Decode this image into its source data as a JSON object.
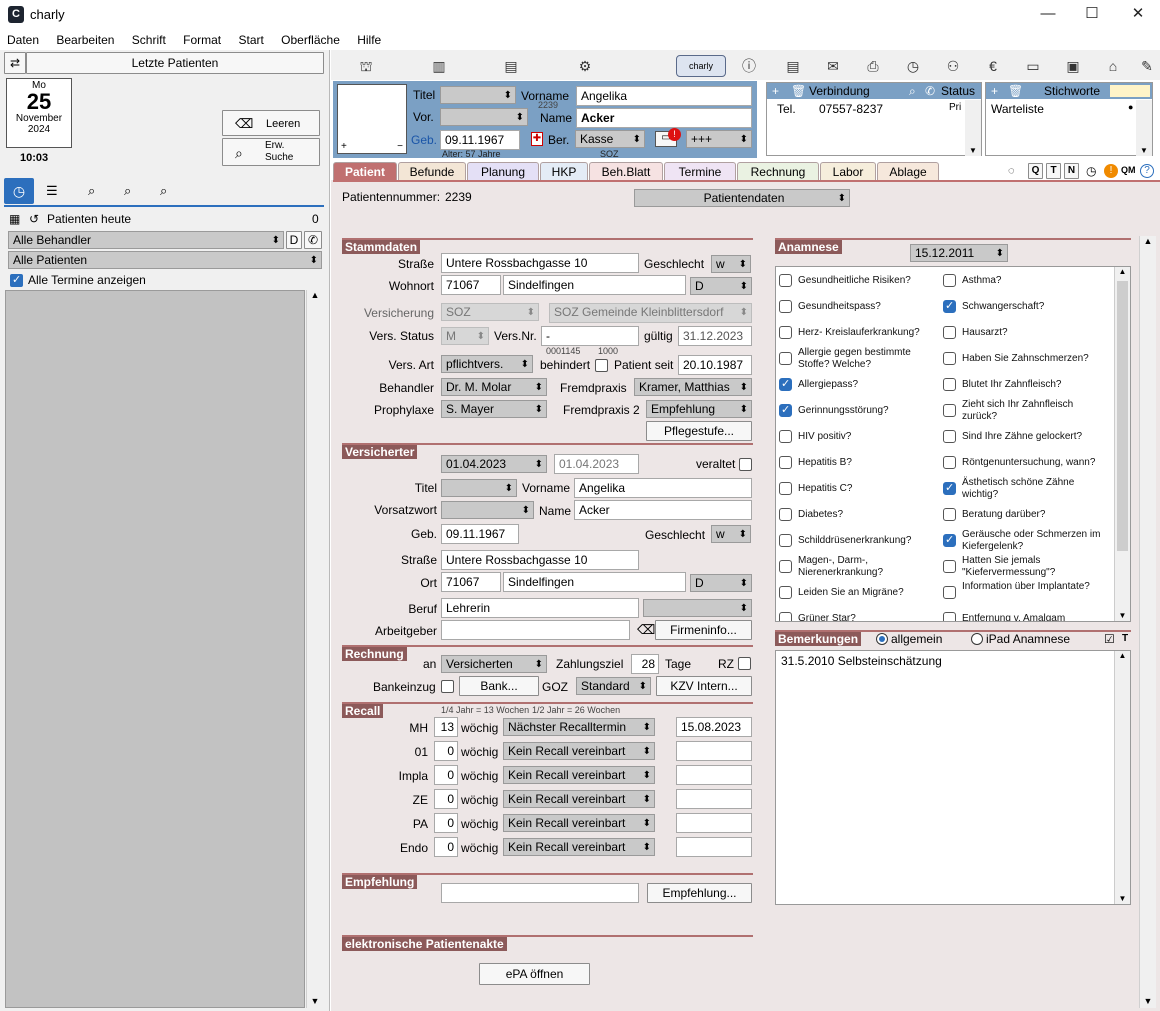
{
  "window": {
    "title": "charly",
    "app_icon": "C",
    "minimize": "—",
    "maximize": "☐",
    "close": "✕"
  },
  "menu": [
    "Daten",
    "Bearbeiten",
    "Schrift",
    "Format",
    "Start",
    "Oberfläche",
    "Hilfe"
  ],
  "left": {
    "swap_icon": "⇄",
    "recent_patients": "Letzte Patienten",
    "calendar": {
      "weekday": "Mo",
      "day": "25",
      "month": "November",
      "year": "2024",
      "time": "10:03"
    },
    "clear_label": "Leeren",
    "ext_search_label_1": "Erw.",
    "ext_search_label_2": "Suche",
    "today_label": "Patienten heute",
    "today_count": "0",
    "behandler": "Alle Behandler",
    "d_label": "D",
    "patients": "Alle Patienten",
    "show_all": "Alle Termine anzeigen"
  },
  "header": {
    "titel_label": "Titel",
    "vorname_label": "Vorname",
    "vorname": "Angelika",
    "id_small": "2239",
    "vor_label": "Vor.",
    "name_label": "Name",
    "name": "Acker",
    "geb_label": "Geb.",
    "geb": "09.11.1967",
    "alter": "Alter: 57 Jahre",
    "ber_label": "Ber.",
    "kasse": "Kasse",
    "kasse_sub": "SOZ",
    "plus": "+++",
    "photo_plus": "+",
    "photo_minus": "−",
    "warn_badge": "!",
    "verbindung": "Verbindung",
    "status": "Status",
    "tel_label": "Tel.",
    "tel": "07557-8237",
    "tel_suffix": "Pri",
    "stichworte": "Stichworte",
    "warteliste": "Warteliste",
    "charly_badge": "charly"
  },
  "tabs": [
    {
      "label": "Patient",
      "bg": "#c07070",
      "color": "#ffffff"
    },
    {
      "label": "Befunde",
      "bg": "#f3e6d6"
    },
    {
      "label": "Planung",
      "bg": "#e4e0f6"
    },
    {
      "label": "HKP",
      "bg": "#e4ecf6"
    },
    {
      "label": "Beh.Blatt",
      "bg": "#f6e2e2"
    },
    {
      "label": "Termine",
      "bg": "#efe4f4"
    },
    {
      "label": "Rechnung",
      "bg": "#eaf2e2"
    },
    {
      "label": "Labor",
      "bg": "#f6eedc"
    },
    {
      "label": "Ablage",
      "bg": "#f6e8dc"
    }
  ],
  "tab_tools": [
    "Q",
    "T",
    "N",
    "QM",
    "?"
  ],
  "patient": {
    "nummer_label": "Patientennummer:",
    "nummer": "2239",
    "view_select": "Patientendaten",
    "stammdaten": {
      "title": "Stammdaten",
      "strasse_label": "Straße",
      "strasse": "Untere Rossbachgasse 10",
      "geschlecht_label": "Geschlecht",
      "geschlecht": "w",
      "wohnort_label": "Wohnort",
      "plz": "71067",
      "ort": "Sindelfingen",
      "land": "D",
      "vers_label": "Versicherung",
      "vers": "SOZ",
      "vers_name": "SOZ Gemeinde Kleinblittersdorf",
      "status_label": "Vers. Status",
      "status": "M",
      "versnr_label": "Vers.Nr.",
      "versnr": "-",
      "gueltig_label": "gültig",
      "gueltig": "31.12.2023",
      "small1": "0001145",
      "small2": "1000",
      "art_label": "Vers. Art",
      "art": "pflichtvers.",
      "behindert_label": "behindert",
      "seit_label": "Patient seit",
      "seit": "20.10.1987",
      "behandler_label": "Behandler",
      "behandler": "Dr. M. Molar",
      "fremd_label": "Fremdpraxis",
      "fremd": "Kramer, Matthias",
      "prophylaxe_label": "Prophylaxe",
      "prophylaxe": "S. Mayer",
      "fremd2_label": "Fremdpraxis 2",
      "fremd2": "Empfehlung",
      "pflege": "Pflegestufe..."
    },
    "versicherter": {
      "title": "Versicherter",
      "date1": "01.04.2023",
      "date2": "01.04.2023",
      "veraltet": "veraltet",
      "titel_label": "Titel",
      "vorname_label": "Vorname",
      "vorname": "Angelika",
      "vorsatz_label": "Vorsatzwort",
      "name_label": "Name",
      "name": "Acker",
      "geb_label": "Geb.",
      "geb": "09.11.1967",
      "geschlecht_label": "Geschlecht",
      "geschlecht": "w",
      "strasse_label": "Straße",
      "strasse": "Untere Rossbachgasse 10",
      "ort_label": "Ort",
      "plz": "71067",
      "ort": "Sindelfingen",
      "land": "D",
      "beruf_label": "Beruf",
      "beruf": "Lehrerin",
      "arbeitgeber_label": "Arbeitgeber",
      "firmen": "Firmeninfo..."
    },
    "rechnung": {
      "title": "Rechnung",
      "an_label": "an",
      "an": "Versicherten",
      "ziel_label": "Zahlungsziel",
      "ziel": "28",
      "tage": "Tage",
      "rz": "RZ",
      "bank_label": "Bankeinzug",
      "bank_btn": "Bank...",
      "goz_label": "GOZ",
      "goz": "Standard",
      "kzv": "KZV Intern..."
    },
    "recall": {
      "title": "Recall",
      "hint1": "1/4 Jahr = 13 Wochen",
      "hint2": "1/2 Jahr = 26 Wochen",
      "rows": [
        {
          "label": "MH",
          "num": "13",
          "unit": "wöchig",
          "select": "Nächster Recalltermin",
          "date": "15.08.2023"
        },
        {
          "label": "01",
          "num": "0",
          "unit": "wöchig",
          "select": "Kein Recall vereinbart",
          "date": ""
        },
        {
          "label": "Impla",
          "num": "0",
          "unit": "wöchig",
          "select": "Kein Recall vereinbart",
          "date": ""
        },
        {
          "label": "ZE",
          "num": "0",
          "unit": "wöchig",
          "select": "Kein Recall vereinbart",
          "date": ""
        },
        {
          "label": "PA",
          "num": "0",
          "unit": "wöchig",
          "select": "Kein Recall vereinbart",
          "date": ""
        },
        {
          "label": "Endo",
          "num": "0",
          "unit": "wöchig",
          "select": "Kein Recall vereinbart",
          "date": ""
        }
      ]
    },
    "empfehlung": {
      "title": "Empfehlung",
      "btn": "Empfehlung..."
    },
    "epa": {
      "title": "elektronische Patientenakte",
      "btn": "ePA öffnen"
    },
    "anamnese": {
      "title": "Anamnese",
      "date": "15.12.2011",
      "left": [
        {
          "t": "Gesundheitliche Risiken?",
          "c": false
        },
        {
          "t": "Gesundheitspass?",
          "c": false
        },
        {
          "t": "Herz- Kreislauferkrankung?",
          "c": false
        },
        {
          "t": "Allergie gegen bestimmte Stoffe? Welche?",
          "c": false
        },
        {
          "t": "Allergiepass?",
          "c": true
        },
        {
          "t": "Gerinnungsstörung?",
          "c": true
        },
        {
          "t": "HIV positiv?",
          "c": false
        },
        {
          "t": "Hepatitis B?",
          "c": false
        },
        {
          "t": "Hepatitis C?",
          "c": false
        },
        {
          "t": "Diabetes?",
          "c": false
        },
        {
          "t": "Schilddrüsenerkrankung?",
          "c": false
        },
        {
          "t": "Magen-, Darm-, Nierenerkrankung?",
          "c": false
        },
        {
          "t": "Leiden Sie an Migräne?",
          "c": false
        },
        {
          "t": "Grüner Star?",
          "c": false
        }
      ],
      "right": [
        {
          "t": "Asthma?",
          "c": false
        },
        {
          "t": "Schwangerschaft?",
          "c": true
        },
        {
          "t": "Hausarzt?",
          "c": false
        },
        {
          "t": "Haben Sie Zahnschmerzen?",
          "c": false
        },
        {
          "t": "Blutet Ihr Zahnfleisch?",
          "c": false
        },
        {
          "t": "Zieht sich Ihr Zahnfleisch zurück?",
          "c": false
        },
        {
          "t": "Sind Ihre Zähne gelockert?",
          "c": false
        },
        {
          "t": "Röntgenuntersuchung, wann?",
          "c": false
        },
        {
          "t": "Ästhetisch schöne Zähne wichtig?",
          "c": true
        },
        {
          "t": "Beratung darüber?",
          "c": false
        },
        {
          "t": "Geräusche oder Schmerzen im Kiefergelenk?",
          "c": true
        },
        {
          "t": "Hatten Sie jemals \"Kiefervermessung\"?",
          "c": false
        },
        {
          "t": "Information über Implantate?",
          "c": false
        },
        {
          "t": "Entfernung v. Amalgam",
          "c": false
        }
      ]
    },
    "bemerkungen": {
      "title": "Bemerkungen",
      "opt1": "allgemein",
      "opt2": "iPad Anamnese",
      "text": "31.5.2010 Selbsteinschätzung"
    }
  }
}
